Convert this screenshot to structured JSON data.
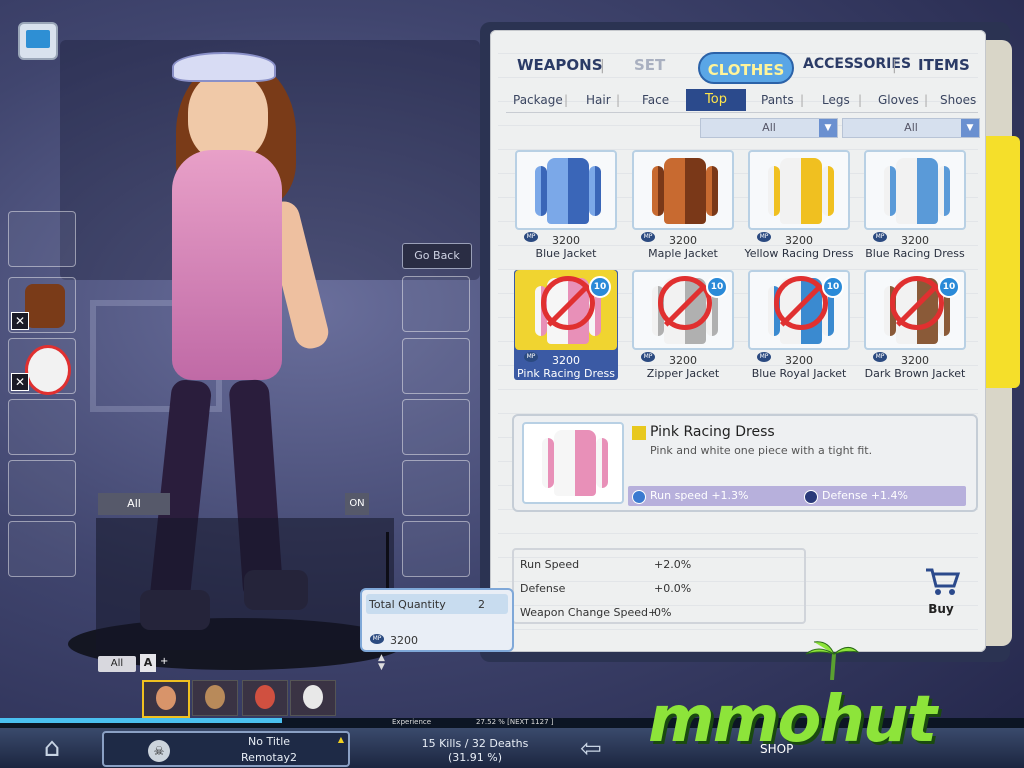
{
  "categories": [
    {
      "label": "WEAPONS",
      "state": "normal"
    },
    {
      "label": "SET",
      "state": "disabled"
    },
    {
      "label": "CLOTHES",
      "state": "active"
    },
    {
      "label": "ACCESSORIES",
      "state": "normal"
    },
    {
      "label": "ITEMS",
      "state": "normal"
    }
  ],
  "subcategories": [
    "Package",
    "Hair",
    "Face",
    "Top",
    "Pants",
    "Legs",
    "Gloves",
    "Shoes"
  ],
  "active_subcategory": "Top",
  "filters": [
    "All",
    "All"
  ],
  "items": [
    {
      "name": "Blue Jacket",
      "price": "3200",
      "badge": "",
      "banned": false,
      "colors": [
        "#7ba8e8",
        "#3a66b8"
      ]
    },
    {
      "name": "Maple Jacket",
      "price": "3200",
      "badge": "",
      "banned": false,
      "colors": [
        "#c86a30",
        "#7a3818"
      ]
    },
    {
      "name": "Yellow Racing Dress",
      "price": "3200",
      "badge": "",
      "banned": false,
      "colors": [
        "#f2f2f2",
        "#f0c020"
      ]
    },
    {
      "name": "Blue Racing Dress",
      "price": "3200",
      "badge": "",
      "banned": false,
      "colors": [
        "#f2f2f2",
        "#5a9ad8"
      ]
    },
    {
      "name": "Pink Racing Dress",
      "price": "3200",
      "badge": "10",
      "banned": true,
      "selected": true,
      "colors": [
        "#f6f6f6",
        "#e890b8"
      ]
    },
    {
      "name": "Zipper Jacket",
      "price": "3200",
      "badge": "10",
      "banned": true,
      "colors": [
        "#f2f2f2",
        "#b0b0b0"
      ]
    },
    {
      "name": "Blue Royal Jacket",
      "price": "3200",
      "badge": "10",
      "banned": true,
      "colors": [
        "#f2f2f2",
        "#3a8ad0"
      ]
    },
    {
      "name": "Dark Brown Jacket",
      "price": "3200",
      "badge": "10",
      "banned": true,
      "colors": [
        "#f2f2f2",
        "#8a5a38"
      ]
    }
  ],
  "detail": {
    "name": "Pink Racing Dress",
    "description": "Pink and white one piece with a tight fit.",
    "bonus1": "Run speed +1.3%",
    "bonus2": "Defense +1.4%"
  },
  "stats": [
    {
      "label": "Run Speed",
      "value": "+2.0%"
    },
    {
      "label": "Defense",
      "value": "+0.0%"
    },
    {
      "label": "Weapon Change Speed+",
      "value": "0%"
    }
  ],
  "buy_label": "Buy",
  "quantity": {
    "label": "Total Quantity",
    "value": "2",
    "price": "3200"
  },
  "go_back": "Go Back",
  "chat": {
    "tab": "All",
    "toggle": "ON",
    "filter": "All",
    "mode": "A",
    "plus": "+"
  },
  "experience": {
    "label": "Experience",
    "value": "27.52 % [NEXT  1127 ]"
  },
  "title_box": {
    "line1": "No Title",
    "line2": "Remotay2"
  },
  "kills": "15 Kills / 32 Deaths",
  "ratio": "(31.91 %)",
  "shop": "SHOP",
  "watermark": "mmohut",
  "colors": {
    "accent": "#2b4a8c",
    "selected": "#f0d430",
    "clothes_tab": "#5aa6e6",
    "bookmark": "#f5df2a",
    "watermark": "#8de43a"
  }
}
